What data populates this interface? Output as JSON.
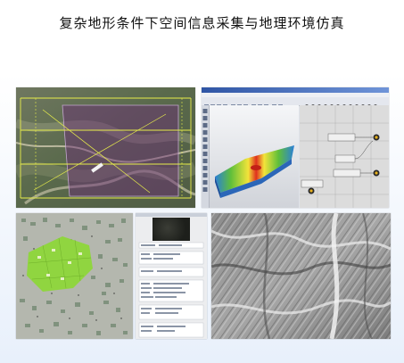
{
  "page": {
    "title": "复杂地形条件下空间信息采集与地理环境仿真"
  },
  "panels": {
    "satellite_flight_planning": {
      "kind": "satellite imagery with flight-line overlays"
    },
    "gis_3d_terrain": {
      "kind": "GIS application with 3D terrain surface and node graph",
      "colors": {
        "terrain_high": "#e0301e",
        "terrain_mid": "#f3e43a",
        "terrain_low": "#2a7fd8"
      }
    },
    "vector_map": {
      "kind": "vector map with highlighted green parcels",
      "colors": {
        "highlight": "#8ed63a"
      }
    },
    "attribute_dialog": {
      "kind": "attribute / properties dialog"
    },
    "hillshade_dem": {
      "kind": "grayscale hillshade elevation model"
    }
  }
}
